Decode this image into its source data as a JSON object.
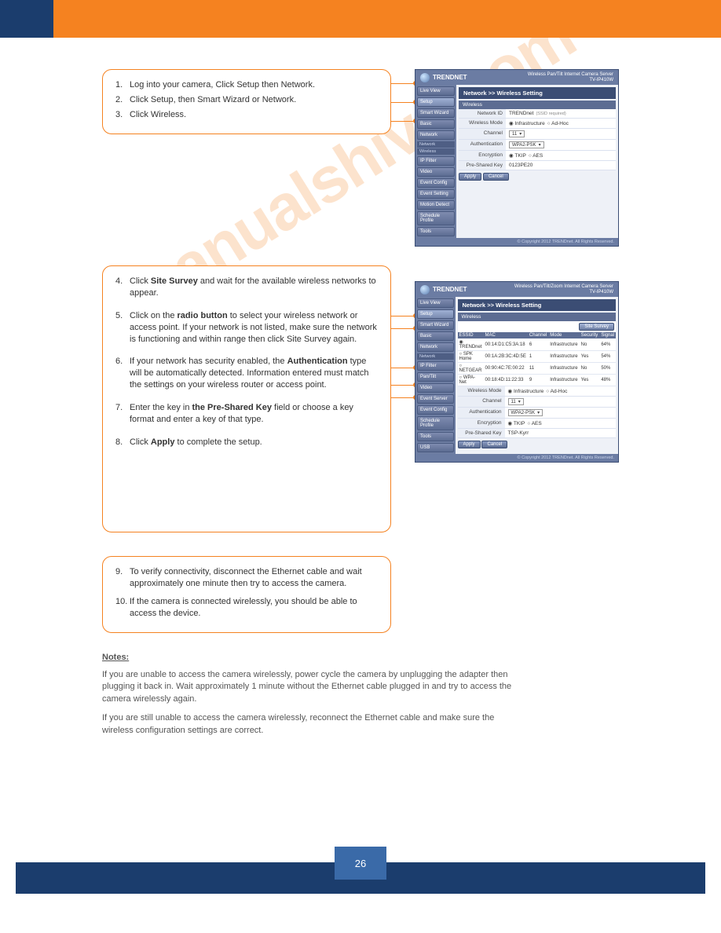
{
  "header": {
    "brand": "TRENDNET"
  },
  "block1": {
    "steps": [
      {
        "num": "1.",
        "text": "Log into your camera, Click Setup then Network."
      },
      {
        "num": "2.",
        "text": "Click Setup, then Smart Wizard or Network."
      },
      {
        "num": "3.",
        "text": "Click Wireless."
      }
    ]
  },
  "shot1": {
    "model_line1": "Wireless Pan/Tilt Internet Camera Server",
    "model_line2": "TV-IP410W",
    "nav": [
      "Live View",
      "Setup",
      "Smart Wizard",
      "Basic",
      "Network",
      "Network",
      "Wireless",
      "IP Filter",
      "Video",
      "Event Config",
      "Event Setting",
      "Motion Detect",
      "Schedule Profile",
      "Tools"
    ],
    "panel_title": "Network >> Wireless Setting",
    "section": "Wireless",
    "rows": [
      {
        "label": "Network ID",
        "value": "TRENDnet",
        "hint": "(SSID required)"
      },
      {
        "label": "Wireless Mode",
        "value": "Infrastructure",
        "radio": true,
        "alt": "Ad-Hoc"
      },
      {
        "label": "Channel",
        "value": "11"
      },
      {
        "label": "Authentication",
        "value": "WPA2-PSK"
      },
      {
        "label": "Encryption",
        "value": "TKIP",
        "alt": "AES",
        "radio": true
      },
      {
        "label": "Pre-Shared Key",
        "value": "0123PE20"
      }
    ],
    "buttons": [
      "Apply",
      "Cancel"
    ]
  },
  "block2": {
    "steps": [
      {
        "num": "4.",
        "text_a": "Click ",
        "b": "Site Survey",
        "text_b": " and wait for the available wireless networks to appear."
      },
      {
        "num": "5.",
        "text_a": "Click on the ",
        "b": "radio button",
        "text_b": " to select your wireless network or access point. If your network is not listed, make sure the network is functioning and within range then click Site Survey again."
      },
      {
        "num": "6.",
        "text_a": "If your network has security enabled, the ",
        "b": "Authentication",
        "text_b": " type will be automatically detected. Information entered must match the settings on your wireless router or access point."
      },
      {
        "num": "7.",
        "text_a": "Enter the key in ",
        "b": "the Pre-Shared Key",
        "text_b": " field or choose a key format and enter a key of that type."
      },
      {
        "num": "8.",
        "text_a": "Click ",
        "b": "Apply",
        "text_b": " to complete the setup."
      }
    ]
  },
  "shot2": {
    "model_line1": "Wireless Pan/Tilt/Zoom Internet Camera Server",
    "model_line2": "TV-IP410W",
    "nav": [
      "Live View",
      "Setup",
      "Smart Wizard",
      "Basic",
      "Network",
      "Network",
      "IP Filter",
      "Pan/Tilt",
      "Video",
      "Event Server",
      "Event Config",
      "Schedule Profile",
      "Tools",
      "USB"
    ],
    "panel_title": "Network >> Wireless Setting",
    "section": "Wireless",
    "site_survey_btn": "Site Survey",
    "table_cols": [
      "ESSID",
      "MAC",
      "Channel",
      "Mode",
      "Security",
      "Signal"
    ],
    "table_rows": [
      [
        "TRENDnet",
        "00:14:D1:C5:3A:18",
        "6",
        "Infrastructure",
        "No",
        "64%"
      ],
      [
        "SPK Home",
        "00:1A:2B:3C:4D:5E",
        "1",
        "Infrastructure",
        "Yes",
        "54%"
      ],
      [
        "NETGEAR",
        "00:90:4C:7E:00:22",
        "11",
        "Infrastructure",
        "No",
        "50%"
      ],
      [
        "WPA-Net",
        "00:18:4D:11:22:33",
        "9",
        "Infrastructure",
        "Yes",
        "48%"
      ]
    ],
    "rows": [
      {
        "label": "Wireless Mode",
        "value": "Infrastructure",
        "radio": true,
        "alt": "Ad-Hoc"
      },
      {
        "label": "Channel",
        "value": "11"
      },
      {
        "label": "Authentication",
        "value": "WPA2-PSK"
      },
      {
        "label": "Encryption",
        "value": "TKIP",
        "alt": "AES",
        "radio": true
      },
      {
        "label": "Pre-Shared Key",
        "value": "TSP-Kyrr"
      }
    ],
    "buttons": [
      "Apply",
      "Cancel"
    ]
  },
  "block3": {
    "steps": [
      {
        "num": "9.",
        "text": "To verify connectivity, disconnect the Ethernet cable and wait approximately one minute then try to access the camera."
      },
      {
        "num": "10.",
        "text": "If the camera is connected wirelessly, you should be able to access the device."
      }
    ]
  },
  "notes": {
    "title": "Notes:",
    "lines": [
      "If you are unable to access the camera wirelessly, power cycle the camera by unplugging the adapter then plugging it back in. Wait approximately 1 minute without the Ethernet cable plugged in and try to access the camera wirelessly again.",
      "If you are still unable to access the camera wirelessly, reconnect the Ethernet cable and make sure the wireless configuration settings are correct."
    ]
  },
  "footer": {
    "copyright": "© Copyright 2012 TRENDnet. All Rights Reserved.",
    "page": "26"
  }
}
